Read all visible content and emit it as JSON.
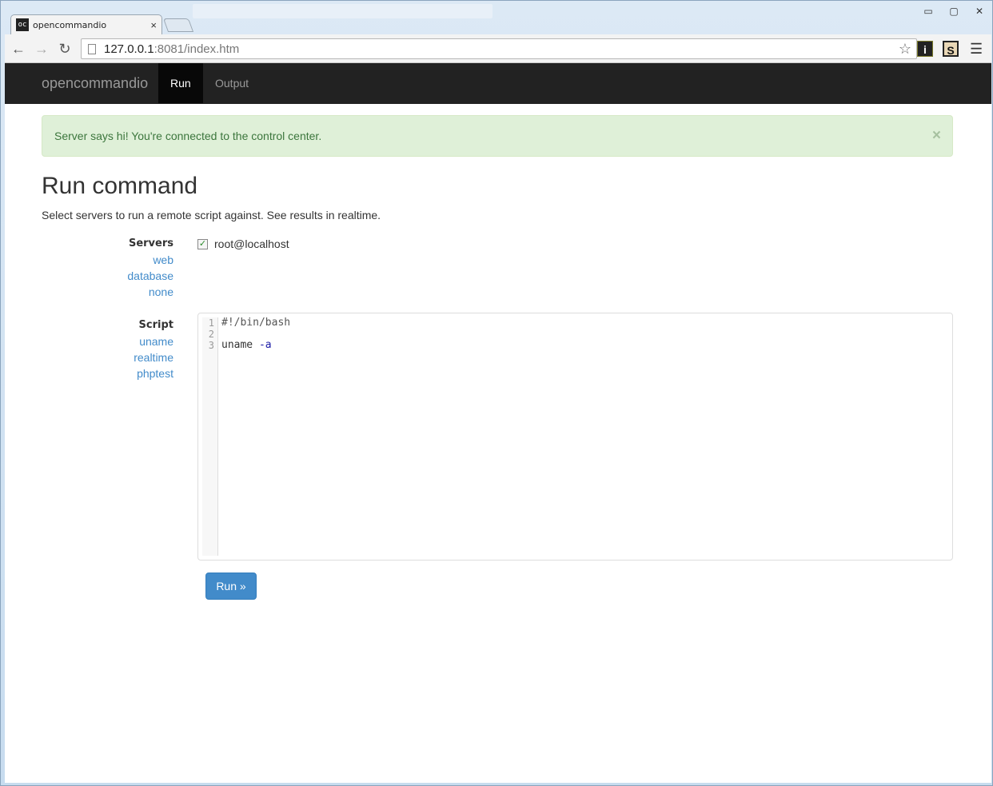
{
  "browser": {
    "tab_title": "opencommandio",
    "tab_favicon": "oc",
    "tab_close": "×",
    "url_host": "127.0.0.1",
    "url_rest": ":8081/index.htm",
    "win_controls": [
      "▭",
      "▢",
      "✕"
    ]
  },
  "navbar": {
    "brand": "opencommandio",
    "items": [
      {
        "label": "Run",
        "active": true
      },
      {
        "label": "Output",
        "active": false
      }
    ]
  },
  "alert": {
    "message": "Server says hi! You're connected to the control center.",
    "close": "×"
  },
  "main": {
    "title": "Run command",
    "lead": "Select servers to run a remote script against. See results in realtime."
  },
  "servers": {
    "label": "Servers",
    "links": [
      "web",
      "database",
      "none"
    ],
    "options": [
      {
        "label": "root@localhost",
        "checked": true
      }
    ]
  },
  "script": {
    "label": "Script",
    "links": [
      "uname",
      "realtime",
      "phptest"
    ],
    "line_numbers": [
      "1",
      "2",
      "3"
    ],
    "lines": [
      "#!/bin/bash",
      "",
      "uname -a"
    ],
    "line3_cmd": "uname",
    "line3_flag": "-a"
  },
  "actions": {
    "run_label": "Run »"
  },
  "colors": {
    "accent": "#428bca",
    "navbar": "#222222",
    "alert_bg": "#dff0d8",
    "alert_text": "#3c763d"
  }
}
